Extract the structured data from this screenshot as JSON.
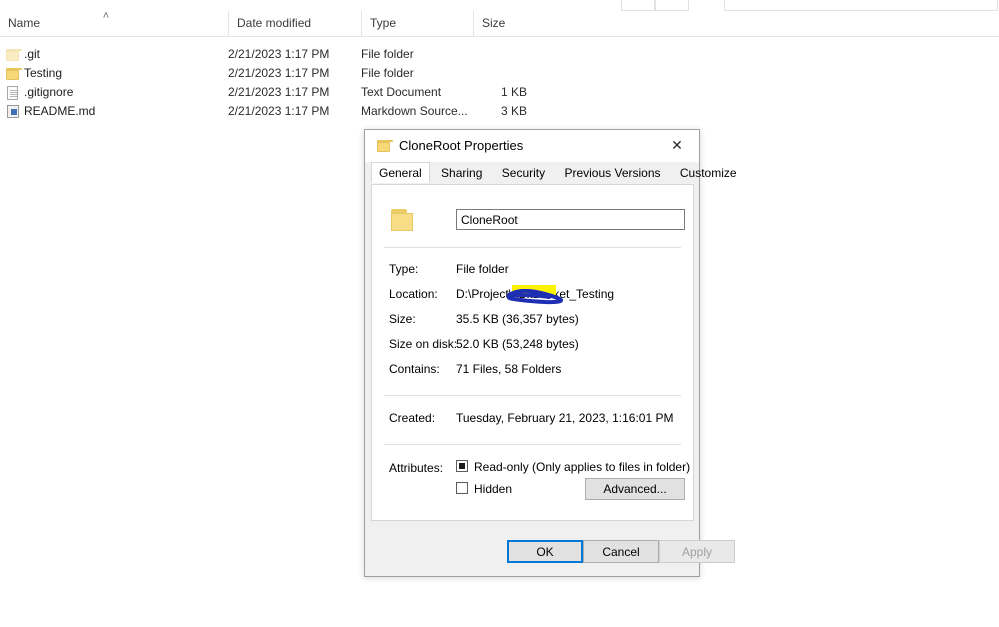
{
  "file_list": {
    "columns": [
      {
        "label": "Name"
      },
      {
        "label": "Date modified"
      },
      {
        "label": "Type"
      },
      {
        "label": "Size"
      }
    ],
    "sort_arrow": "˄",
    "rows": [
      {
        "icon": "folder-icon-dim",
        "name": ".git",
        "date": "2/21/2023 1:17 PM",
        "type": "File folder",
        "size": ""
      },
      {
        "icon": "folder-icon",
        "name": "Testing",
        "date": "2/21/2023 1:17 PM",
        "type": "File folder",
        "size": ""
      },
      {
        "icon": "text-document-icon",
        "name": ".gitignore",
        "date": "2/21/2023 1:17 PM",
        "type": "Text Document",
        "size": "1 KB"
      },
      {
        "icon": "markdown-file-icon",
        "name": "README.md",
        "date": "2/21/2023 1:17 PM",
        "type": "Markdown Source...",
        "size": "3 KB"
      }
    ]
  },
  "dialog": {
    "title": "CloneRoot Properties",
    "title_icon": "folder-icon",
    "close_icon": "✕",
    "tabs": [
      {
        "label": "General",
        "active": true
      },
      {
        "label": "Sharing",
        "active": false
      },
      {
        "label": "Security",
        "active": false
      },
      {
        "label": "Previous Versions",
        "active": false
      },
      {
        "label": "Customize",
        "active": false
      }
    ],
    "name_field": {
      "value": "CloneRoot",
      "icon": "folder-icon"
    },
    "properties": [
      {
        "label": "Type:",
        "value": "File folder"
      },
      {
        "label": "Location:",
        "value": "D:\\Project\\                \\BitBucket_Testing"
      },
      {
        "label": "Size:",
        "value": "35.5 KB (36,357 bytes)"
      },
      {
        "label": "Size on disk:",
        "value": "52.0 KB (53,248 bytes)"
      },
      {
        "label": "Contains:",
        "value": "71 Files, 58 Folders"
      }
    ],
    "created": {
      "label": "Created:",
      "value": "Tuesday, February 21, 2023, 1:16:01 PM"
    },
    "attributes": {
      "label": "Attributes:",
      "read_only": {
        "text": "Read-only (Only applies to files in folder)",
        "state": "indeterminate"
      },
      "hidden": {
        "text": "Hidden",
        "state": "unchecked"
      },
      "advanced_button": "Advanced..."
    },
    "buttons": {
      "ok": "OK",
      "cancel": "Cancel",
      "apply": "Apply"
    },
    "redaction": {
      "highlight_color": "#fdf200",
      "scribble_color": "#1f2fb4"
    }
  }
}
